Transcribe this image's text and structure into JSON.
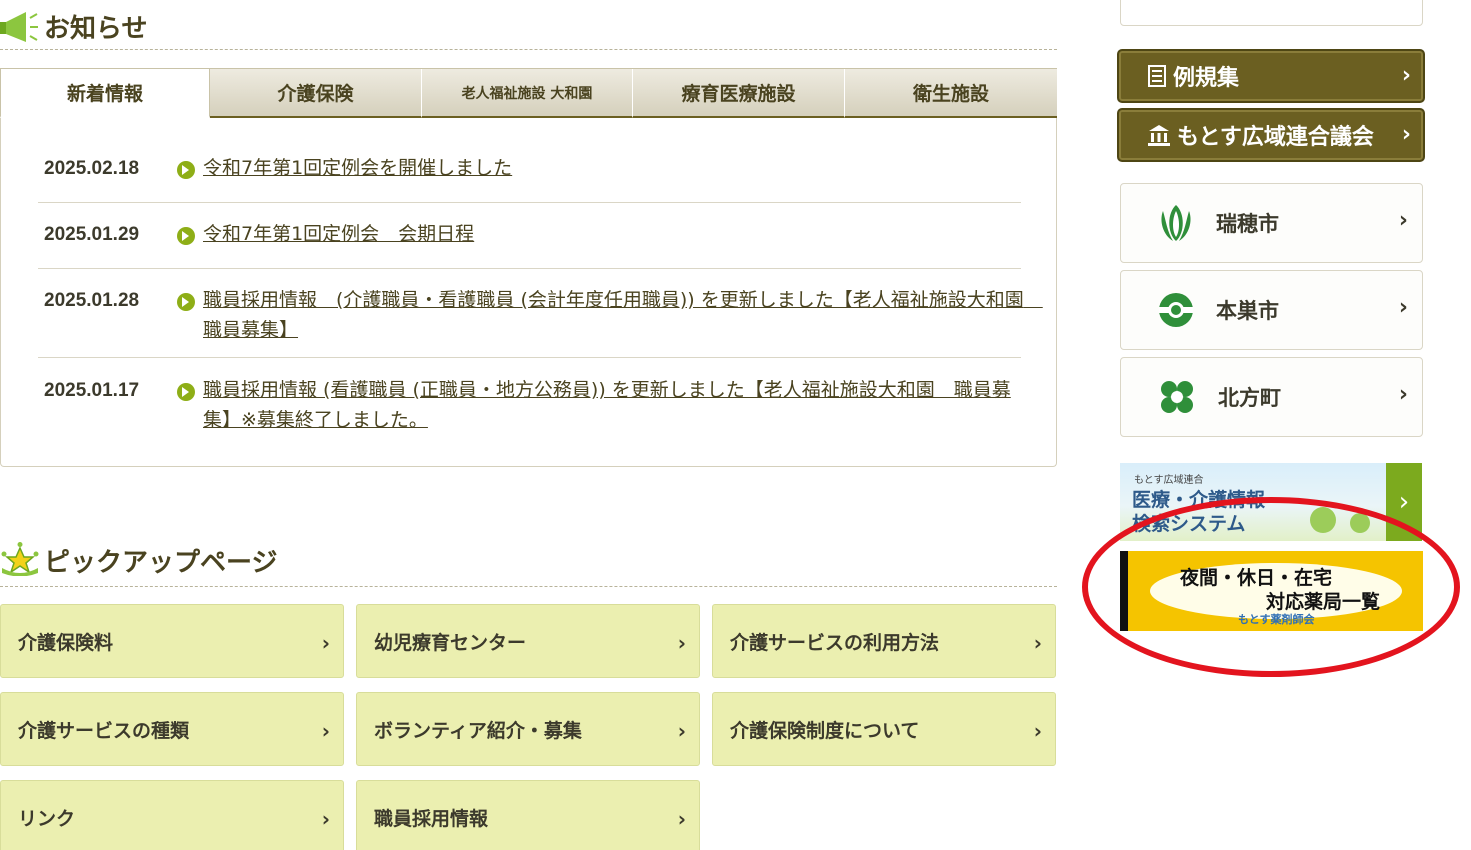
{
  "news": {
    "title": "お知らせ",
    "tabs": [
      {
        "label": "新着情報",
        "active": true
      },
      {
        "label": "介護保険",
        "active": false
      },
      {
        "label": "老人福祉施設 大和園",
        "active": false
      },
      {
        "label": "療育医療施設",
        "active": false
      },
      {
        "label": "衛生施設",
        "active": false
      }
    ],
    "items": [
      {
        "date": "2025.02.18",
        "text": "令和7年第1回定例会を開催しました"
      },
      {
        "date": "2025.01.29",
        "text": "令和7年第1回定例会　会期日程"
      },
      {
        "date": "2025.01.28",
        "text": "職員採用情報　(介護職員・看護職員 (会計年度任用職員)) を更新しました【老人福祉施設大和園　職員募集】"
      },
      {
        "date": "2025.01.17",
        "text": "職員採用情報 (看護職員 (正職員・地方公務員)) を更新しました【老人福祉施設大和園　職員募集】※募集終了しました。"
      }
    ]
  },
  "pickup": {
    "title": "ピックアップページ",
    "items": [
      "介護保険料",
      "幼児療育センター",
      "介護サービスの利用方法",
      "介護サービスの種類",
      "ボランティア紹介・募集",
      "介護保険制度について",
      "リンク",
      "職員採用情報"
    ]
  },
  "sidebar": {
    "buttons": [
      "例規集",
      "もとす広域連合議会"
    ],
    "cities": [
      "瑞穂市",
      "本巣市",
      "北方町"
    ],
    "banner_medical": {
      "small": "もとす広域連合",
      "line1": "医療・介護情報",
      "line2": "検索システム"
    },
    "banner_pharmacy": {
      "line1": "夜間・休日・在宅",
      "line2": "対応薬局一覧",
      "sub": "もとす薬剤師会"
    }
  },
  "colors": {
    "brand_dark": "#6b5f21",
    "pickup_bg": "#ebefb0",
    "accent_green": "#8eae17",
    "highlight_red": "#e3141e"
  }
}
